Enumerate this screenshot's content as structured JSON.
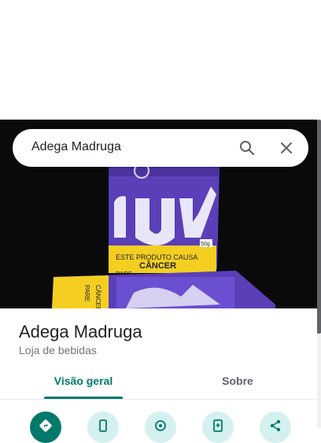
{
  "search": {
    "query": "Adega Madruga"
  },
  "hero": {
    "photo_text": {
      "warning_line1": "ESTE PRODUTO CAUSA",
      "warning_line2": "CÂNCER",
      "warning_partial": "PARE",
      "weight": "50g",
      "back_pack_line1": "PARE",
      "back_pack_line2": "CÂNCER"
    }
  },
  "place": {
    "name": "Adega Madruga",
    "category": "Loja de bebidas"
  },
  "tabs": [
    {
      "label": "Visão geral",
      "selected": true
    },
    {
      "label": "Sobre",
      "selected": false
    }
  ],
  "actions": [
    {
      "icon": "directions-icon"
    },
    {
      "icon": "phone-icon"
    },
    {
      "icon": "share-location-icon"
    },
    {
      "icon": "save-to-phone-icon"
    },
    {
      "icon": "share-icon"
    }
  ],
  "colors": {
    "accent": "#00796b",
    "action_bg": "#d4f1f0",
    "pack_purple": "#5a3fb8",
    "warning_yellow": "#f4cf22"
  }
}
